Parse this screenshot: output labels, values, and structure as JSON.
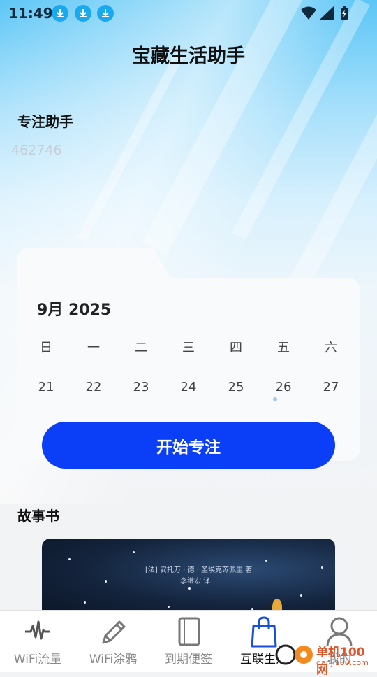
{
  "status_bar": {
    "time": "11:49"
  },
  "header": {
    "title": "宝藏生活助手"
  },
  "focus": {
    "section_title": "专注助手",
    "id_text": "462746"
  },
  "calendar": {
    "month_label": "9月  2025",
    "weekdays": [
      "日",
      "一",
      "二",
      "三",
      "四",
      "五",
      "六"
    ],
    "days": [
      "21",
      "22",
      "23",
      "24",
      "25",
      "26",
      "27"
    ],
    "marked_day": "26",
    "start_button": "开始专注"
  },
  "story": {
    "section_title": "故事书",
    "book_author": "[法] 安托万 · 德 · 圣埃克苏佩里 著",
    "book_translator": "李继宏 译"
  },
  "tabbar": {
    "tabs": [
      {
        "label": "WiFi流量",
        "icon": "pulse-icon"
      },
      {
        "label": "WiFi涂鸦",
        "icon": "pencil-icon"
      },
      {
        "label": "到期便签",
        "icon": "note-icon"
      },
      {
        "label": "互联生活",
        "icon": "shopping-bag-icon",
        "active": true
      },
      {
        "label": "我的",
        "icon": "user-icon"
      }
    ]
  },
  "watermark": {
    "text": "单机100网",
    "sub": "danji100.com"
  },
  "colors": {
    "accent": "#0a3ff7",
    "active_tab": "#1a4fd8",
    "sky": "#5cc6f6"
  }
}
